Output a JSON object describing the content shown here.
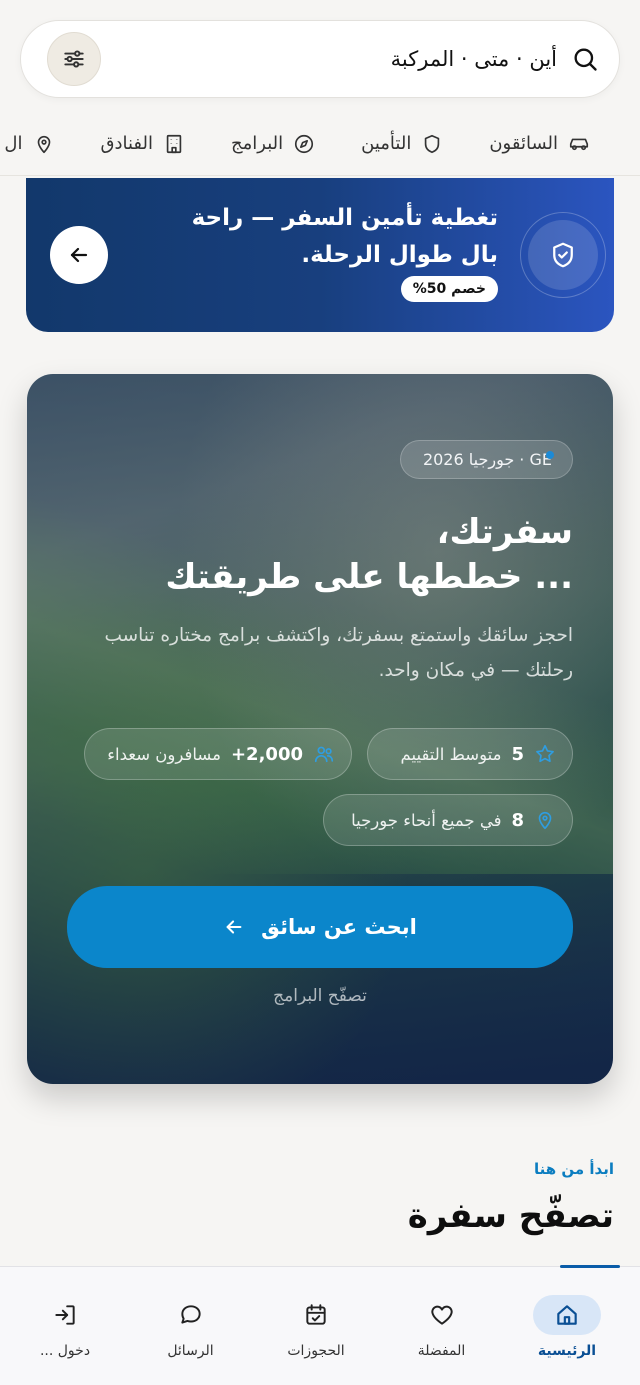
{
  "search": {
    "text": "أين · متى · المركبة",
    "icon": "search-icon",
    "filter_icon": "sliders-icon"
  },
  "categories": [
    {
      "label": "السائقون",
      "icon": "car-icon"
    },
    {
      "label": "التأمين",
      "icon": "shield-icon"
    },
    {
      "label": "البرامج",
      "icon": "compass-icon"
    },
    {
      "label": "الفنادق",
      "icon": "building-icon"
    },
    {
      "label": "ال",
      "icon": "location-pin-icon"
    }
  ],
  "promo": {
    "title": "تغطية تأمين السفر — راحة بال طوال الرحلة.",
    "badge": "خصم 50%",
    "icon": "shield-check-icon",
    "arrow_icon": "arrow-left-icon"
  },
  "hero": {
    "chip": "GE · جورجيا 2026",
    "title_line1": "سفرتك،",
    "title_line2": "... خططها على طريقتك",
    "subtitle": "احجز سائقك واستمتع بسفرتك، واكتشف برامج مختاره تناسب رحلتك — في مكان واحد.",
    "stats": {
      "rating": {
        "value": "5",
        "label": "متوسط التقييم",
        "icon": "star-icon"
      },
      "travelers": {
        "value": "+2,000",
        "label": "مسافرون سعداء",
        "icon": "users-icon"
      },
      "locations": {
        "value": "8",
        "label": "في جميع أنحاء جورجيا",
        "icon": "location-pin-icon"
      }
    },
    "cta_label": "ابحث عن سائق",
    "link_label": "تصفّح البرامج"
  },
  "section": {
    "eyebrow": "ابدأ من هنا",
    "title": "تصفّح سفرة"
  },
  "bottom_nav": [
    {
      "label": "الرئيسية",
      "icon": "home-icon",
      "active": true
    },
    {
      "label": "المفضلة",
      "icon": "heart-icon",
      "active": false
    },
    {
      "label": "الحجوزات",
      "icon": "calendar-check-icon",
      "active": false
    },
    {
      "label": "الرسائل",
      "icon": "chat-bubble-icon",
      "active": false
    },
    {
      "label": "دخول ...",
      "icon": "login-icon",
      "active": false
    }
  ],
  "colors": {
    "accent": "#0b86cb",
    "promo_start": "#12386b",
    "promo_end": "#2b55c0",
    "nav_active": "#0a4f94"
  }
}
